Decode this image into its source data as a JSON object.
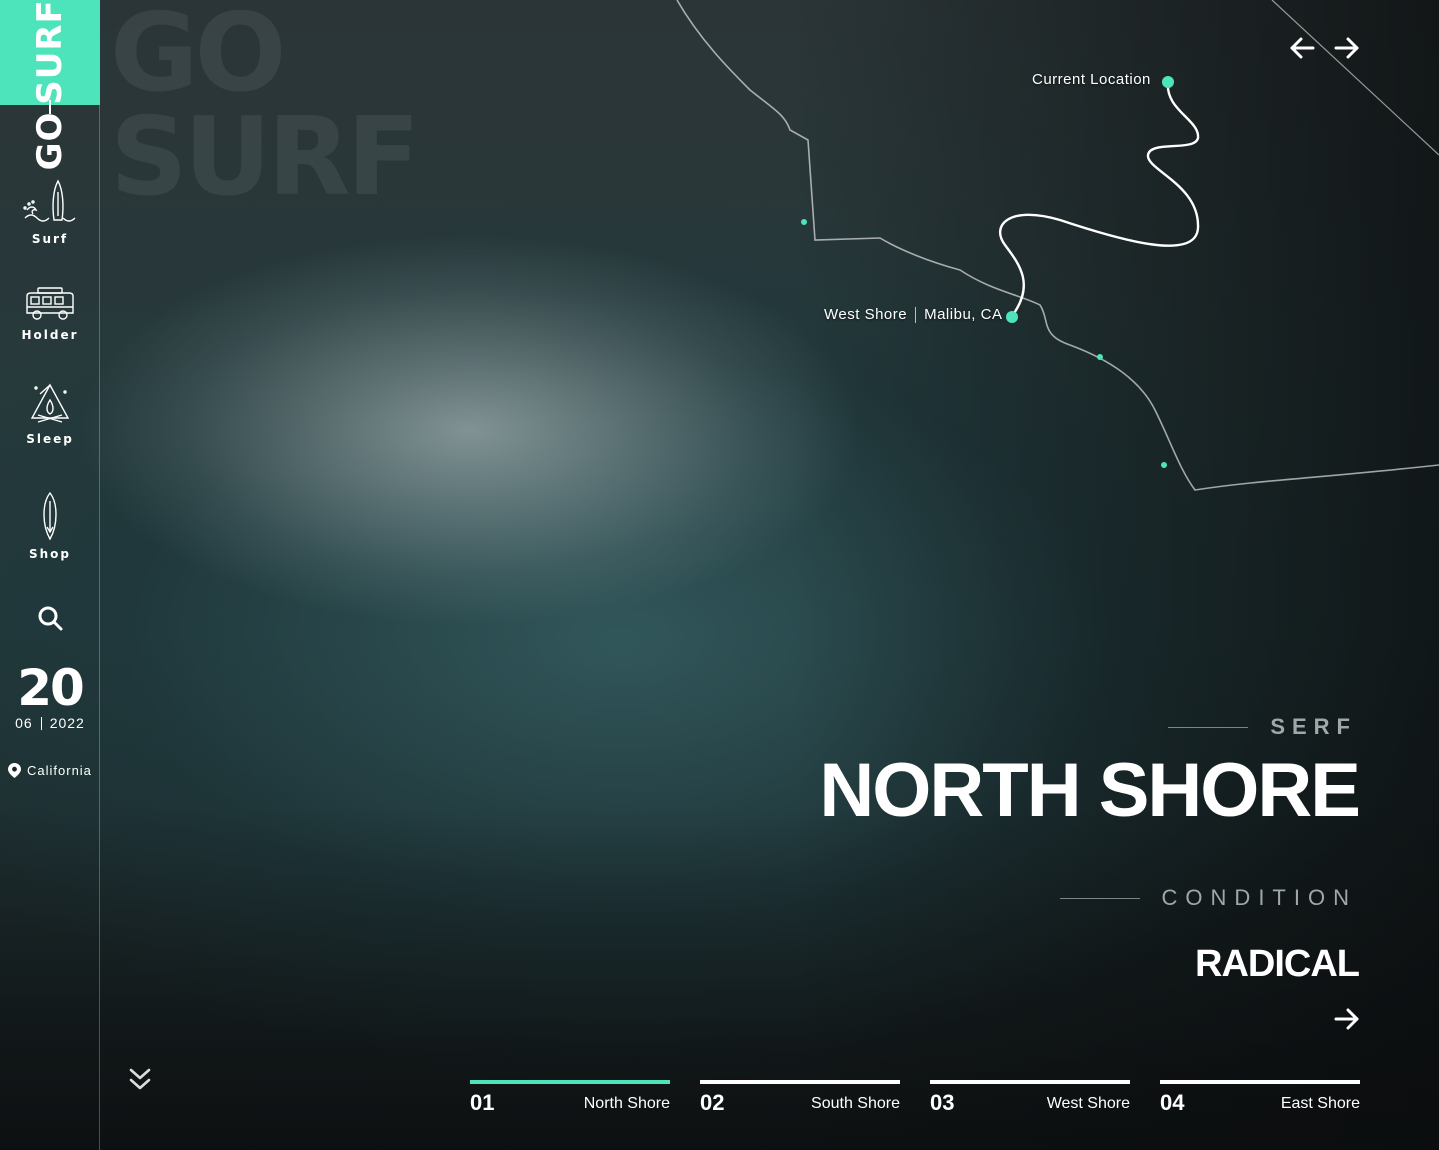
{
  "brand": {
    "logo_top": "SURF",
    "logo_bottom": "GO",
    "ghost_line1": "GO",
    "ghost_line2": "SURF",
    "accent_color": "#4ee4bb"
  },
  "sidebar": {
    "items": [
      {
        "label": "Surf",
        "icon": "surfboard-wave-icon"
      },
      {
        "label": "Holder",
        "icon": "camper-van-icon"
      },
      {
        "label": "Sleep",
        "icon": "campfire-tent-icon"
      },
      {
        "label": "Shop",
        "icon": "surfboard-icon"
      }
    ],
    "search_icon": "search-icon",
    "date": {
      "day": "20",
      "month": "06",
      "year": "2022"
    },
    "location": "California"
  },
  "map": {
    "current_location": "Current Location",
    "spot_name": "West Shore",
    "spot_city": "Malibu, CA"
  },
  "hero": {
    "eyebrow": "SERF",
    "title": "NORTH SHORE",
    "condition_label": "CONDITION",
    "condition_value": "RADICAL"
  },
  "tabs": [
    {
      "num": "01",
      "name": "North Shore",
      "active": true
    },
    {
      "num": "02",
      "name": "South Shore",
      "active": false
    },
    {
      "num": "03",
      "name": "West Shore",
      "active": false
    },
    {
      "num": "04",
      "name": "East Shore",
      "active": false
    }
  ]
}
